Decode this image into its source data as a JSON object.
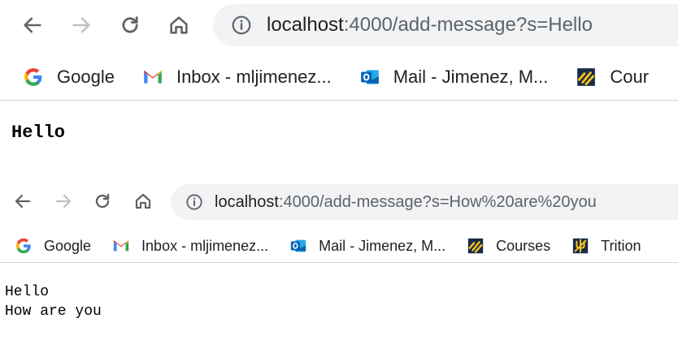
{
  "screenshots": [
    {
      "url_host": "localhost",
      "url_rest": ":4000/add-message?s=Hello",
      "bookmarks": [
        "Google",
        "Inbox - mljimenez...",
        "Mail - Jimenez, M...",
        "Cour"
      ],
      "messages": [
        "Hello"
      ]
    },
    {
      "url_host": "localhost",
      "url_rest": ":4000/add-message?s=How%20are%20you",
      "bookmarks": [
        "Google",
        "Inbox - mljimenez...",
        "Mail - Jimenez, M...",
        "Courses",
        "Trition"
      ],
      "messages": [
        "Hello",
        "How are you"
      ]
    }
  ],
  "icons": {
    "back": "back-arrow-icon",
    "forward": "forward-arrow-icon",
    "reload": "reload-icon",
    "home": "home-icon",
    "site_info": "info-icon",
    "google": "google-icon",
    "gmail": "gmail-icon",
    "outlook": "outlook-icon",
    "courses": "courses-icon",
    "trition": "trition-icon"
  },
  "colors": {
    "omnibox_bg": "#f1f3f4",
    "url_host": "#202124",
    "url_rest": "#5f6368",
    "divider": "#d5d5d5"
  }
}
